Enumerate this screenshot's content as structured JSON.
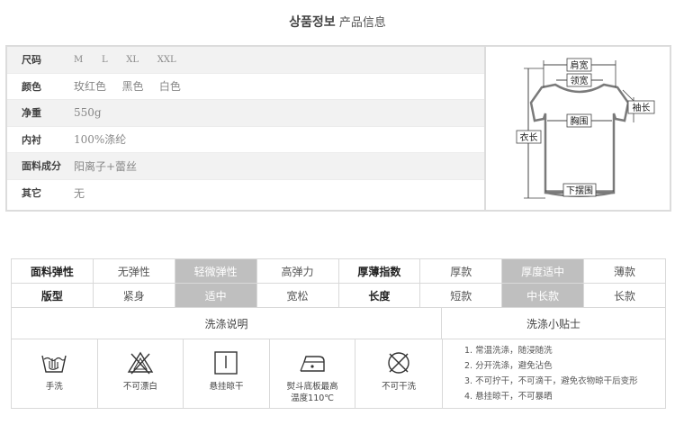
{
  "header": {
    "title_ko": "상품정보",
    "title_cn": "产品信息"
  },
  "info": {
    "rows": [
      {
        "key": "尺码",
        "value": "M    L    XL    XXL"
      },
      {
        "key": "颜色",
        "value": "玫红色   黑色   白色"
      },
      {
        "key": "净重",
        "value": "550g"
      },
      {
        "key": "内衬",
        "value": "100%涤纶"
      },
      {
        "key": "面料成分",
        "value": "阳离子+蕾丝"
      },
      {
        "key": "其它",
        "value": "无"
      }
    ],
    "diagram_labels": {
      "shoulder": "肩宽",
      "collar": "领宽",
      "sleeve": "袖长",
      "chest": "胸围",
      "length": "衣长",
      "hem": "下摆围"
    }
  },
  "attributes": {
    "row1": [
      "面料弹性",
      "无弹性",
      "轻微弹性",
      "高弹力",
      "厚薄指数",
      "厚款",
      "厚度适中",
      "薄款"
    ],
    "row2": [
      "版型",
      "紧身",
      "适中",
      "宽松",
      "长度",
      "短款",
      "中长款",
      "长款"
    ]
  },
  "care": {
    "wash_title": "洗涤说明",
    "tips_title": "洗涤小贴士",
    "icons": [
      {
        "icon": "hand-wash-icon",
        "label": "手洗"
      },
      {
        "icon": "no-bleach-icon",
        "label": "不可漂白"
      },
      {
        "icon": "hang-dry-icon",
        "label": "悬挂晾干"
      },
      {
        "icon": "iron-icon",
        "label_1": "熨斗底板最高",
        "label_2": "温度110℃"
      },
      {
        "icon": "no-dry-clean-icon",
        "label": "不可干洗"
      }
    ],
    "tips": [
      "1. 常温洗涤，随浸随洗",
      "2. 分开洗涤，避免沾色",
      "3. 不可拧干，不可滴干，避免衣物晾干后变形",
      "4. 悬挂晾干，不可暴晒"
    ]
  }
}
